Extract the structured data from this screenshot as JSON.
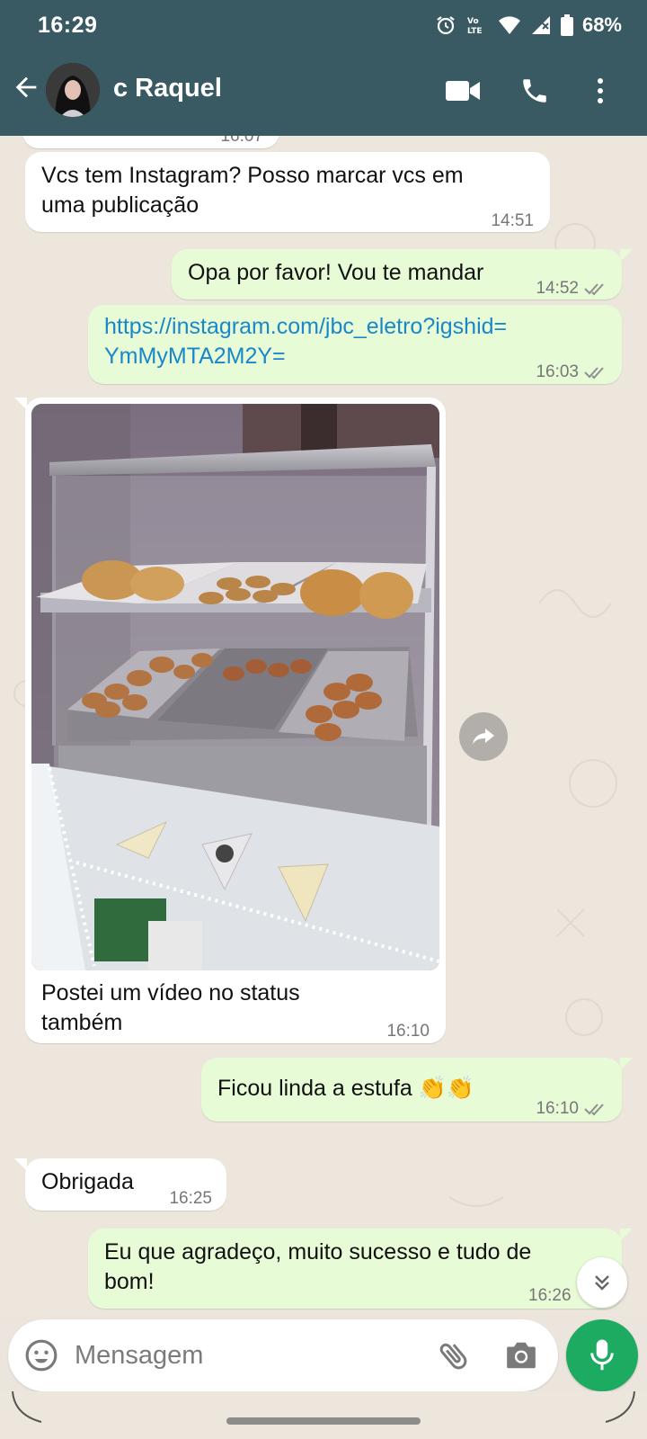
{
  "status_bar": {
    "time": "16:29",
    "battery": "68%",
    "icons": [
      "alarm-icon",
      "volte-icon",
      "wifi-icon",
      "signal-icon",
      "battery-icon"
    ]
  },
  "header": {
    "contact_name": "c Raquel",
    "icons": [
      "back-arrow-icon",
      "avatar",
      "video-call-icon",
      "voice-call-icon",
      "more-vert-icon"
    ],
    "bar_color": "#3a5a63"
  },
  "messages": [
    {
      "direction": "in",
      "text_line1": "Vcs tem Instagram? Posso marcar vcs em",
      "text_line2": "uma publicação",
      "time": "14:51"
    },
    {
      "direction": "out",
      "text": "Opa por favor! Vou te mandar",
      "time": "14:52",
      "status": "read-ticks-icon"
    },
    {
      "direction": "out",
      "text_line1": "https://instagram.com/jbc_eletro?igshid=",
      "text_line2": "YmMyMTA2M2Y=",
      "time": "16:03",
      "status": "read-ticks-icon"
    },
    {
      "direction": "in",
      "type": "image",
      "caption_line1": "Postei um vídeo no status",
      "caption_line2": "também",
      "time": "16:10"
    },
    {
      "direction": "out",
      "text": "Ficou linda a estufa",
      "emoji": "👏👏",
      "time": "16:10",
      "status": "read-ticks-icon"
    },
    {
      "direction": "in",
      "text": "Obrigada",
      "time": "16:25"
    },
    {
      "direction": "out",
      "text_line1": "Eu que agradeço, muito sucesso e tudo de",
      "text_line2": "bom!",
      "time": "16:26"
    }
  ],
  "partial_time_top": "16:07",
  "composer": {
    "placeholder": "Mensagem"
  },
  "colors": {
    "outgoing_bubble": "#e7fbd6",
    "incoming_bubble": "#ffffff",
    "link": "#1b87c9",
    "mic_button": "#1daa61",
    "chat_background": "#ede6dc"
  }
}
